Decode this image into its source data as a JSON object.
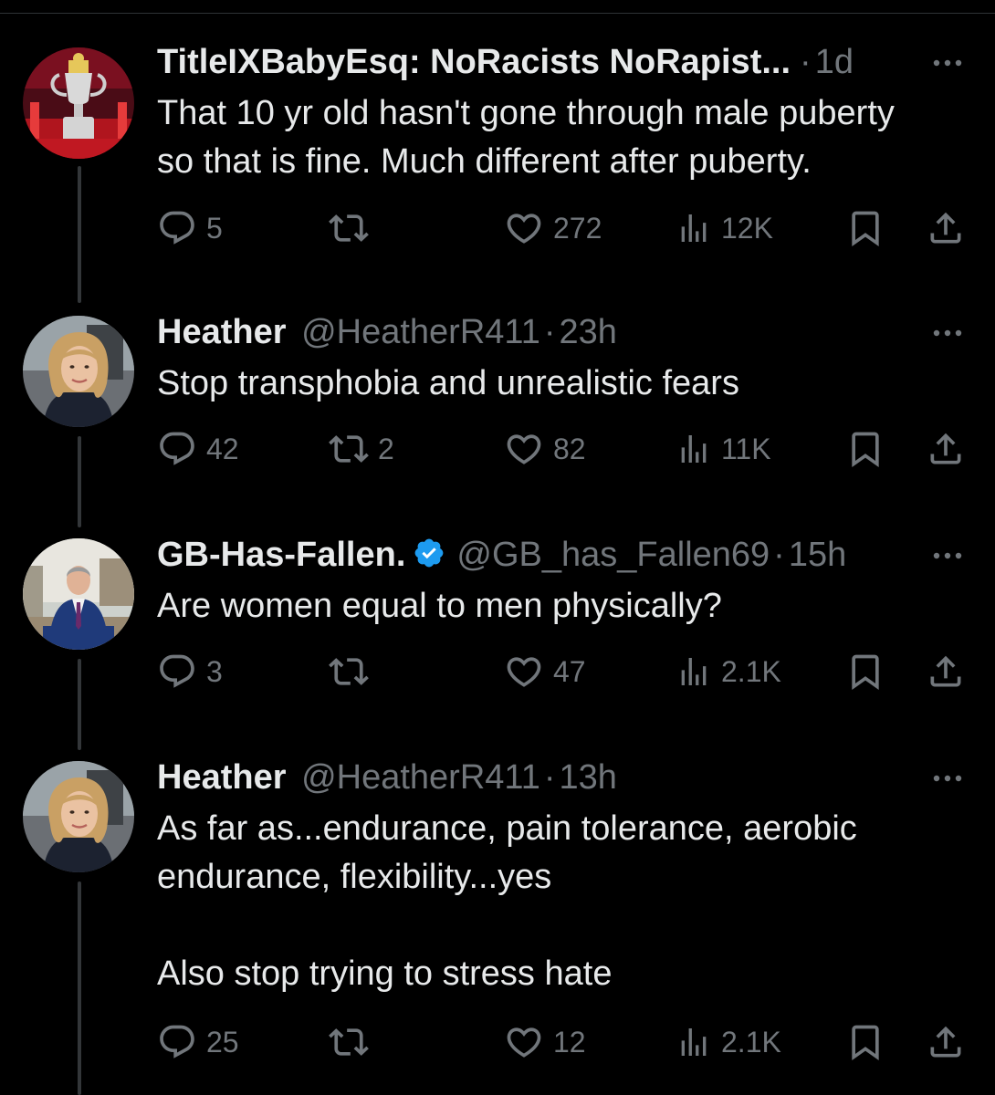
{
  "theme": {
    "background": "#000000",
    "text": "#e7e9ea",
    "muted": "#71767b",
    "verified": "#1d9bf0",
    "thread_line": "#333639"
  },
  "tweets": [
    {
      "name": "TitleIXBabyEsq: NoRacists NoRapist...",
      "handle": "",
      "separator": "·",
      "time": "1d",
      "verified": false,
      "avatar": "trophy-avatar",
      "text": "That 10 yr old hasn't gone through male puberty\nso that is fine. Much different after puberty.",
      "replies": "5",
      "reposts": "",
      "likes": "272",
      "views": "12K"
    },
    {
      "name": "Heather",
      "handle": "@HeatherR411",
      "separator": "·",
      "time": "23h",
      "verified": false,
      "avatar": "woman-avatar",
      "text": "Stop transphobia and unrealistic fears",
      "replies": "42",
      "reposts": "2",
      "likes": "82",
      "views": "11K"
    },
    {
      "name": "GB-Has-Fallen.",
      "handle": "@GB_has_Fallen69",
      "separator": "·",
      "time": "15h",
      "verified": true,
      "avatar": "man-in-suit-avatar",
      "text": "Are women equal to men physically?",
      "replies": "3",
      "reposts": "",
      "likes": "47",
      "views": "2.1K"
    },
    {
      "name": "Heather",
      "handle": "@HeatherR411",
      "separator": "·",
      "time": "13h",
      "verified": false,
      "avatar": "woman-avatar",
      "text": "As far as...endurance, pain tolerance, aerobic\nendurance, flexibility...yes\n\nAlso stop trying to stress hate",
      "replies": "25",
      "reposts": "",
      "likes": "12",
      "views": "2.1K"
    }
  ]
}
